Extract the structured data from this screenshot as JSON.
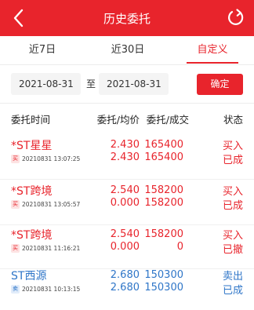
{
  "header": {
    "title": "历史委托",
    "back_icon": "chevron-left-icon",
    "refresh_icon": "refresh-icon",
    "bg_color": "#e8242c"
  },
  "tabs": [
    {
      "label": "近7日",
      "active": false
    },
    {
      "label": "近30日",
      "active": false
    },
    {
      "label": "自定义",
      "active": true
    }
  ],
  "date_range": {
    "start": "2021-08-31",
    "separator": "至",
    "end": "2021-08-31",
    "confirm_label": "确定"
  },
  "columns": {
    "time": "委托时间",
    "price": "委托/均价",
    "volume": "委托/成交",
    "status": "状态"
  },
  "orders": [
    {
      "name": "*ST星星",
      "badge": "买",
      "datetime": "20210831 13:07:25",
      "order_price": "2.430",
      "avg_price": "2.430",
      "order_qty": "165400",
      "filled_qty": "165400",
      "side": "买入",
      "status": "已成"
    },
    {
      "name": "*ST跨境",
      "badge": "买",
      "datetime": "20210831 13:05:57",
      "order_price": "2.540",
      "avg_price": "0.000",
      "order_qty": "158200",
      "filled_qty": "158200",
      "side": "买入",
      "status": "已成"
    },
    {
      "name": "*ST跨境",
      "badge": "买",
      "datetime": "20210831 11:16:21",
      "order_price": "2.540",
      "avg_price": "0.000",
      "order_qty": "158200",
      "filled_qty": "0",
      "side": "买入",
      "status": "已撤"
    },
    {
      "name": "ST西源",
      "badge": "卖",
      "datetime": "20210831 10:13:15",
      "order_price": "2.680",
      "avg_price": "2.680",
      "order_qty": "150300",
      "filled_qty": "150300",
      "side": "卖出",
      "status": "已成"
    }
  ],
  "colors": {
    "buy": "#e8242c",
    "sell": "#2f76c8"
  }
}
